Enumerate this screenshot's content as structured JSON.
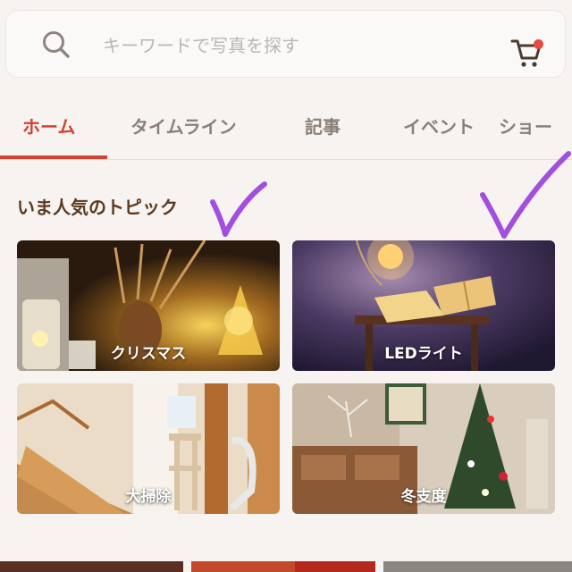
{
  "search": {
    "placeholder": "キーワードで写真を探す"
  },
  "tabs": [
    {
      "label": "ホーム",
      "active": true
    },
    {
      "label": "タイムライン"
    },
    {
      "label": "記事"
    },
    {
      "label": "イベント"
    },
    {
      "label": "ショー"
    }
  ],
  "section": {
    "title": "いま人気のトピック"
  },
  "topics": [
    {
      "label": "クリスマス"
    },
    {
      "label": "LEDライト"
    },
    {
      "label": "大掃除"
    },
    {
      "label": "冬支度"
    }
  ],
  "colors": {
    "accent": "#d4432f",
    "checkmark": "#a24fe0",
    "badge": "#e44b3a"
  }
}
